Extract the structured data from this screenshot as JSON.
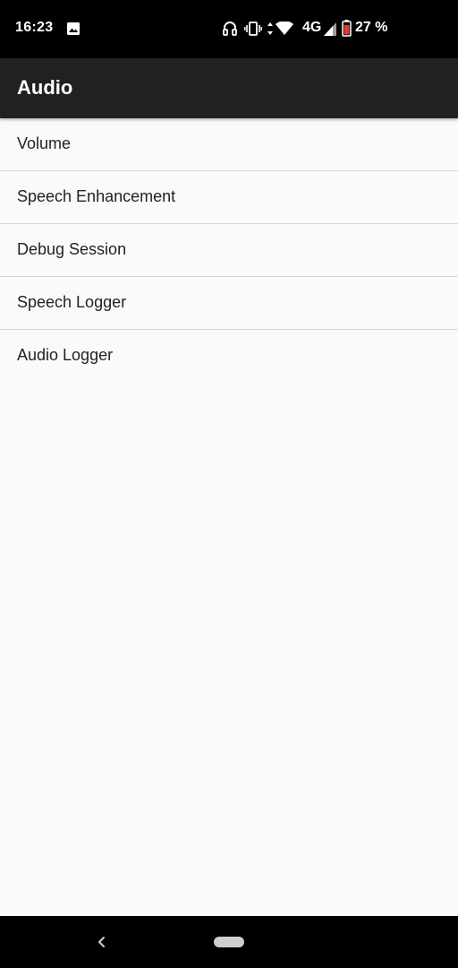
{
  "status_bar": {
    "time": "16:23",
    "network": "4G",
    "battery": "27 %",
    "icons": [
      "photo-icon",
      "headset-icon",
      "vibrate-icon",
      "data-arrows-icon",
      "wifi-icon",
      "signal-icon",
      "battery-icon"
    ],
    "battery_color": "#e53935"
  },
  "app_bar": {
    "title": "Audio",
    "background": "#212121"
  },
  "menu": {
    "items": [
      {
        "label": "Volume"
      },
      {
        "label": "Speech Enhancement"
      },
      {
        "label": "Debug Session"
      },
      {
        "label": "Speech Logger"
      },
      {
        "label": "Audio Logger"
      }
    ]
  },
  "nav_bar": {
    "icons": [
      "back-icon",
      "home-pill-icon"
    ]
  }
}
